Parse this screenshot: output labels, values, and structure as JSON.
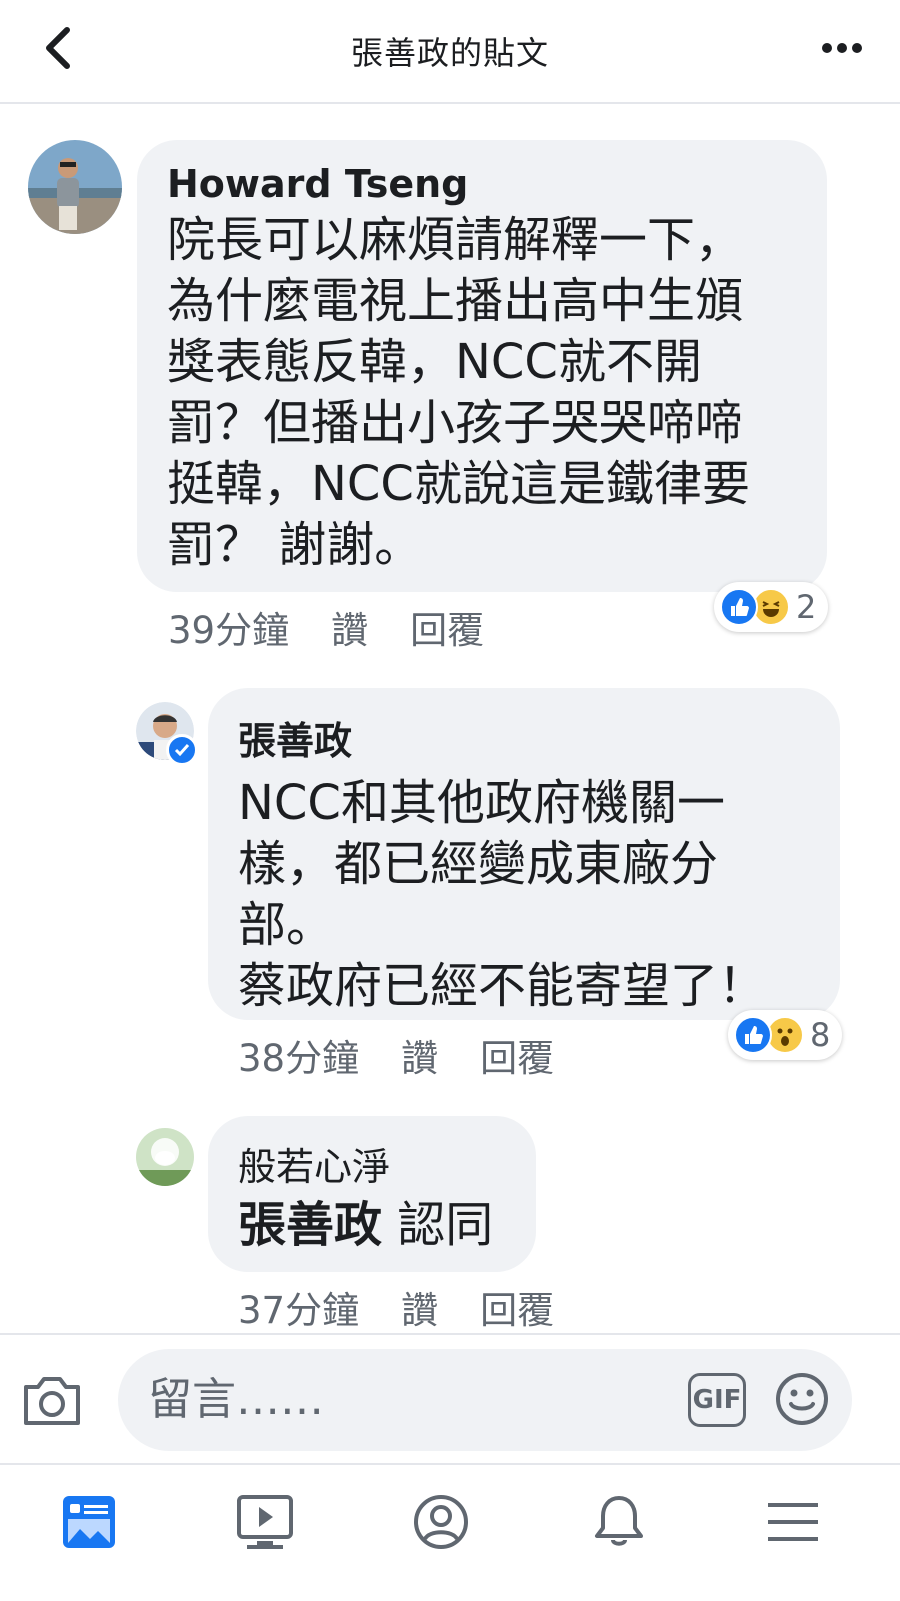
{
  "header": {
    "title": "張善政的貼文",
    "back_icon": "chevron-left-icon",
    "more_icon": "more-horizontal-icon"
  },
  "comments": [
    {
      "author": "Howard Tseng",
      "text": "院長可以麻煩請解釋一下，\n為什麼電視上播出高中生頒\n獎表態反韓，NCC就不開\n罰？但播出小孩子哭哭啼啼\n挺韓，NCC就說這是鐵律要\n罰？ 謝謝。",
      "time": "39分鐘",
      "like_label": "讚",
      "reply_label": "回覆",
      "reactions": [
        "like",
        "haha"
      ],
      "reaction_count": "2"
    },
    {
      "author": "張善政",
      "verified": true,
      "text": "NCC和其他政府機關一\n樣，都已經變成東廠分\n部。\n蔡政府已經不能寄望了！",
      "time": "38分鐘",
      "like_label": "讚",
      "reply_label": "回覆",
      "reactions": [
        "like",
        "wow"
      ],
      "reaction_count": "8"
    },
    {
      "author": "般若心淨",
      "mention": "張善政",
      "text": " 認同",
      "time": "37分鐘",
      "like_label": "讚",
      "reply_label": "回覆"
    }
  ],
  "composer": {
    "placeholder": "留言……",
    "gif_label": "GIF",
    "camera_icon": "camera-icon",
    "emoji_icon": "smiley-icon"
  },
  "bottom_nav": [
    "news-feed-icon",
    "video-icon",
    "profile-icon",
    "notifications-icon",
    "menu-icon"
  ],
  "colors": {
    "accent": "#1877f2",
    "bubble": "#f0f2f5",
    "meta_text": "#606770",
    "reaction_yellow": "#f7c948"
  }
}
